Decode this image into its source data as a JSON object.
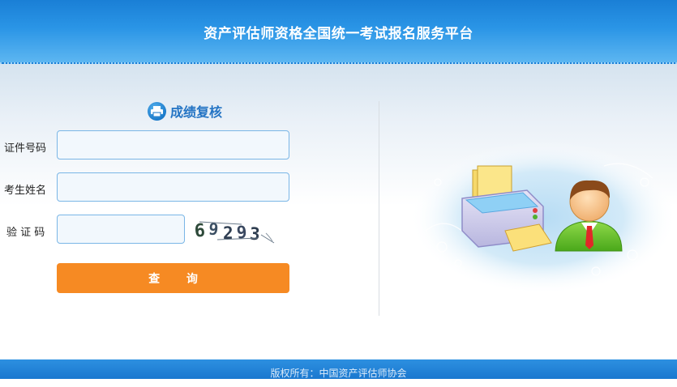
{
  "header": {
    "title": "资产评估师资格全国统一考试报名服务平台"
  },
  "panel": {
    "title": "成绩复核",
    "icon": "printer-icon",
    "fields": {
      "id_label": "证件号码",
      "id_value": "",
      "name_label": "考生姓名",
      "name_value": "",
      "captcha_label": "验 证 码",
      "captcha_value": ""
    },
    "captcha_image_text": "69293",
    "query_button": "查 询"
  },
  "illustration": {
    "icons": [
      "printer-icon",
      "person-icon"
    ]
  },
  "footer": {
    "copyright": "版权所有：中国资产评估师协会"
  },
  "colors": {
    "header_blue": "#2a95e6",
    "title_blue": "#2474c4",
    "button_orange": "#f68a23",
    "footer_blue": "#1a78cf"
  }
}
